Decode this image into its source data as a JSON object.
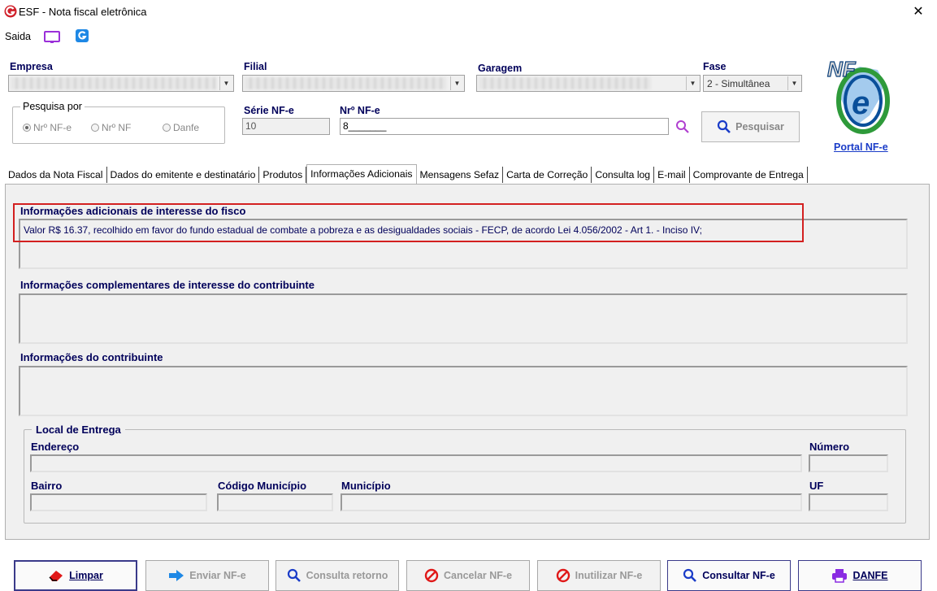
{
  "window": {
    "title": "ESF - Nota fiscal eletrônica",
    "close": "✕"
  },
  "toolbar": {
    "saida_label": "Saida"
  },
  "header": {
    "empresa_label": "Empresa",
    "filial_label": "Filial",
    "garagem_label": "Garagem",
    "fase_label": "Fase",
    "fase_value": "2 - Simultânea",
    "pesquisa_label": "Pesquisa por",
    "radios": [
      "Nrº NF-e",
      "Nrº NF",
      "Danfe"
    ],
    "serie_label": "Série NF-e",
    "serie_value": "10",
    "numero_label": "Nrº NF-e",
    "numero_value": "8_______",
    "pesquisar_label": "Pesquisar",
    "portal_label": "Portal NF-e"
  },
  "tabs": [
    "Dados da Nota Fiscal",
    "Dados do emitente e destinatário",
    "Produtos",
    "Informações Adicionais",
    "Mensagens Sefaz",
    "Carta de Correção",
    "Consulta log",
    "E-mail",
    "Comprovante de Entrega"
  ],
  "active_tab": "Informações Adicionais",
  "content": {
    "fisco_title": "Informações adicionais de interesse do fisco",
    "fisco_text": "Valor R$ 16.37, recolhido em favor do fundo estadual de combate a pobreza e as desigualdades sociais - FECP, de acordo Lei 4.056/2002 - Art 1. - Inciso IV;",
    "complementares_title": "Informações complementares de interesse do contribuinte",
    "contribuinte_title": "Informações do contribuinte",
    "local_title": "Local de Entrega",
    "endereco_label": "Endereço",
    "numero_label": "Número",
    "bairro_label": "Bairro",
    "codigo_municipio_label": "Código Município",
    "municipio_label": "Município",
    "uf_label": "UF"
  },
  "buttons": {
    "limpar": "Limpar",
    "enviar": "Enviar NF-e",
    "consulta_retorno": "Consulta retorno",
    "cancelar": "Cancelar NF-e",
    "inutilizar": "Inutilizar NF-e",
    "consultar": "Consultar NF-e",
    "danfe": "DANFE"
  },
  "colors": {
    "accent": "#00005a",
    "highlight": "#d32020",
    "brand_red": "#d0202a",
    "icon_purple": "#8a2be2"
  }
}
